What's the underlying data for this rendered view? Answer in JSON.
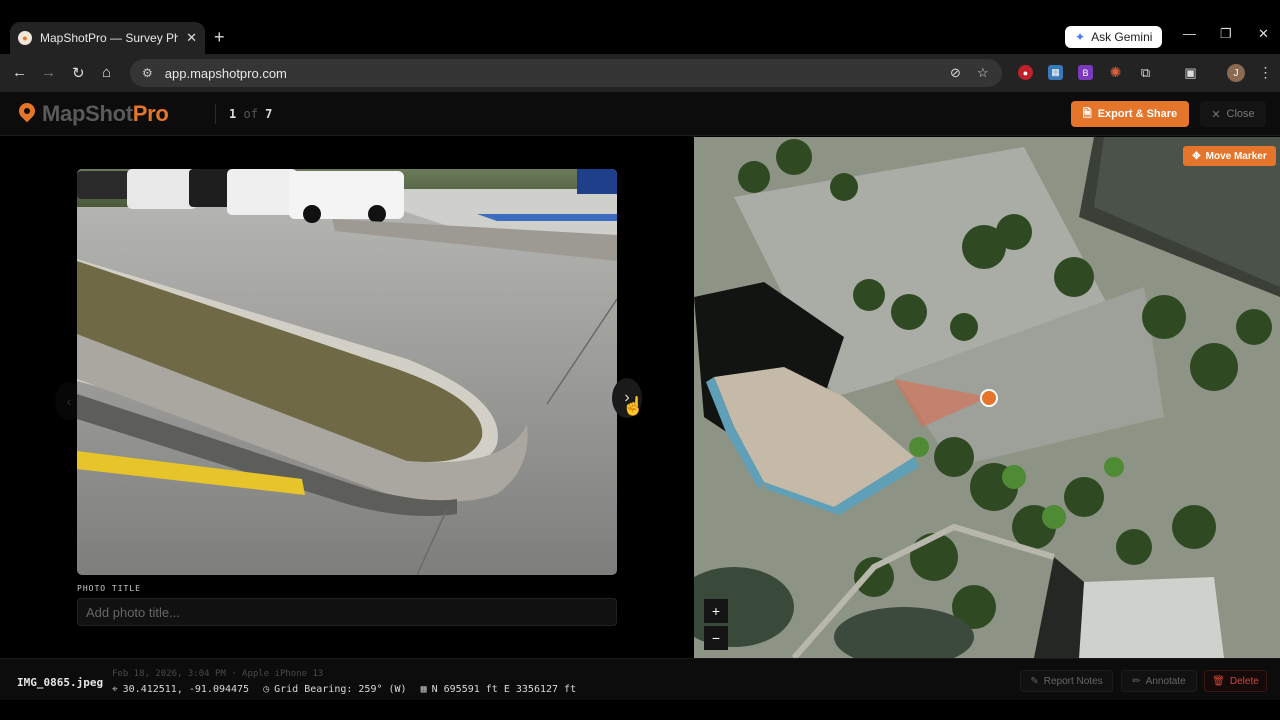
{
  "browser": {
    "tab_title": "MapShotPro — Survey Photo M",
    "url": "app.mapshotpro.com",
    "ask_gemini": "Ask Gemini",
    "profile_initial": "J"
  },
  "app": {
    "logo_part1": "MapShot",
    "logo_part2": "Pro",
    "counter_current": "1",
    "counter_of": "of",
    "counter_total": "7",
    "export_label": "Export & Share",
    "close_label": "Close"
  },
  "photo": {
    "title_label": "PHOTO TITLE",
    "title_placeholder": "Add photo title..."
  },
  "map": {
    "move_marker_label": "Move Marker",
    "zoom_in": "+",
    "zoom_out": "−"
  },
  "footer": {
    "filename": "IMG_0865.jpeg",
    "meta": "Feb 18, 2026, 3:04 PM · Apple iPhone 13",
    "coords": "30.412511, -91.094475",
    "bearing": "Grid Bearing: 259° (W)",
    "grid": "N 695591 ft E 3356127 ft",
    "report_notes": "Report Notes",
    "annotate": "Annotate",
    "delete": "Delete"
  },
  "colors": {
    "accent": "#e4752a",
    "danger": "#d4453a"
  }
}
